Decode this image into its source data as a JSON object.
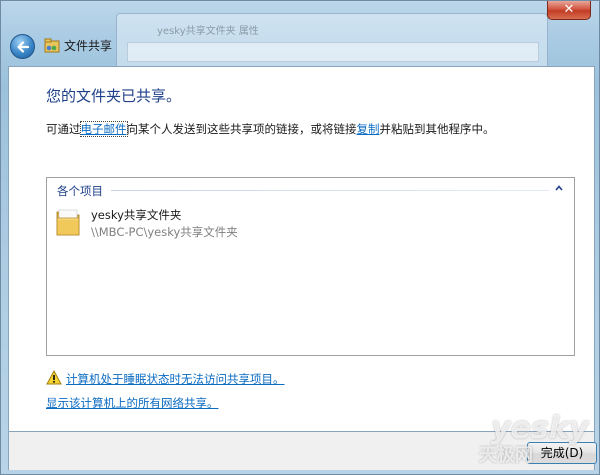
{
  "window": {
    "nav_title": "文件共享",
    "background_window_title": "yesky共享文件夹 属性",
    "close_glyph": "✕"
  },
  "content": {
    "heading": "您的文件夹已共享。",
    "desc_prefix": "可通过",
    "desc_email_link": "电子邮件",
    "desc_middle": "向某个人发送到这些共享项的链接，或将链接",
    "desc_copy_link": "复制",
    "desc_suffix": "并粘贴到其他程序中。"
  },
  "list": {
    "group_header": "各个项目",
    "items": [
      {
        "name": "yesky共享文件夹",
        "path": "\\\\MBC-PC\\yesky共享文件夹"
      }
    ]
  },
  "links": {
    "sleep_warning": "计算机处于睡眠状态时无法访问共享项目。",
    "show_all_shares": "显示该计算机上的所有网络共享。"
  },
  "footer": {
    "done_label": "完成(D)"
  },
  "watermark": {
    "text": "yesky",
    "sub": "天极网"
  },
  "colors": {
    "heading": "#1e3f8a",
    "link": "#0b6bc2",
    "chrome": "#9fc3dc"
  }
}
